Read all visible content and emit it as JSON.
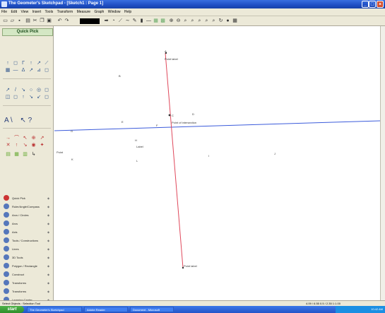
{
  "window": {
    "title": "The Geometer's Sketchpad - [Sketch1 : Page 1]",
    "controls": [
      "_",
      "□",
      "×"
    ]
  },
  "menu": [
    "File",
    "Edit",
    "View",
    "Insert",
    "Tools",
    "Transform",
    "Measure",
    "Graph",
    "Window",
    "Help"
  ],
  "toolbar": {
    "icons": [
      "new-icon",
      "open-icon",
      "save-icon",
      "print-icon",
      "cut-icon",
      "copy-icon",
      "paste-icon",
      "undo-icon",
      "redo-icon"
    ],
    "accent": "#000000"
  },
  "quick_pick": {
    "title": "Quick Pick",
    "tool_rows_1": [
      "↑",
      "◻",
      "Γ",
      "↑",
      "↗",
      "⟋",
      "▦",
      "—",
      "Δ",
      "↗",
      "⊿",
      "◻"
    ],
    "tool_rows_2": [
      "↗",
      "/",
      "↘",
      "○",
      "◎",
      "◻",
      "◫",
      "◻",
      "↑",
      "↘",
      "↙",
      "◻"
    ],
    "text_tools": [
      "A",
      "\\",
      "↖",
      "?"
    ],
    "tool_rows_3": [
      "→",
      "⌒",
      "↖",
      "⊕",
      "↗",
      "✕",
      "↑",
      "↘",
      "◉",
      "✦"
    ],
    "tool_rows_4": [
      "▤",
      "▦",
      "▥",
      "↳"
    ]
  },
  "categories": [
    {
      "label": "Quick Pick",
      "color": "#cc3333"
    },
    {
      "label": "Ruler/Angle/Compass",
      "color": "#4466aa"
    },
    {
      "label": "Arcs / Circles",
      "color": "#4466aa"
    },
    {
      "label": "Arcs",
      "color": "#4466aa"
    },
    {
      "label": "Axis",
      "color": "#4466aa"
    },
    {
      "label": "Tools / Constructions",
      "color": "#4466aa"
    },
    {
      "label": "Lines",
      "color": "#4466aa"
    },
    {
      "label": "3D Tools",
      "color": "#4466aa"
    },
    {
      "label": "Polygon / Rectangle",
      "color": "#4466aa"
    },
    {
      "label": "Construct",
      "color": "#4466aa"
    },
    {
      "label": "Transforms",
      "color": "#4466aa"
    },
    {
      "label": "Transforms",
      "color": "#4466aa"
    },
    {
      "label": "Learning Center",
      "color": "#4466aa"
    }
  ],
  "canvas_labels": [
    {
      "id": "A",
      "text": "A"
    },
    {
      "id": "B",
      "text": "B"
    },
    {
      "id": "C",
      "text": "C"
    },
    {
      "id": "D",
      "text": "D"
    },
    {
      "id": "E",
      "text": "E"
    },
    {
      "id": "F",
      "text": "F"
    },
    {
      "id": "G",
      "text": "G"
    },
    {
      "id": "H",
      "text": "H"
    },
    {
      "id": "I",
      "text": "I"
    },
    {
      "id": "J",
      "text": "J"
    },
    {
      "id": "K",
      "text": "K"
    },
    {
      "id": "L",
      "text": "L"
    }
  ],
  "canvas_notes": {
    "top_point": "Point label",
    "center_point": "Point of intersection",
    "left_point": "Point",
    "mid_point": "Label",
    "bottom_point": "Point label"
  },
  "colors": {
    "line_blue": "#3b5bdb",
    "line_red": "#e0485b"
  },
  "status": {
    "left": "Select Objects : Selection Tool",
    "right": "4.09 / 6.55    0.5 / 2.35   1:1.00"
  },
  "taskbar": {
    "start": "start",
    "tasks": [
      "The Geometer's Sketchpad",
      "Adobe Reader",
      "Document - Microsoft"
    ],
    "clock": "10:42 AM"
  }
}
